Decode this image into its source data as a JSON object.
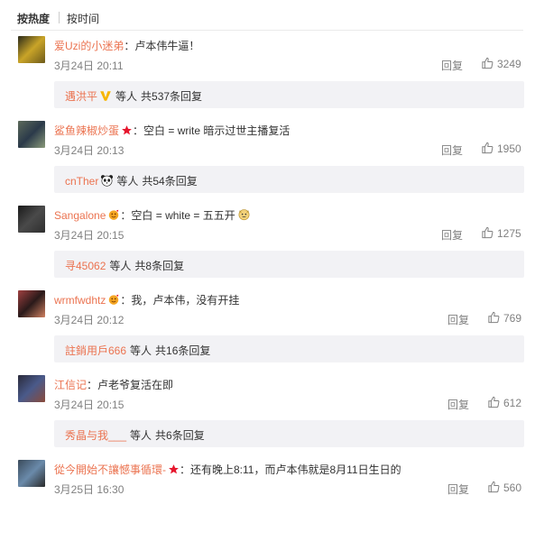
{
  "sort": {
    "hot": "按热度",
    "time": "按时间"
  },
  "comments": [
    {
      "user": "爱Uzi的小迷弟",
      "text": "：卢本伟牛逼！",
      "time": "3月24日 20:11",
      "reply": "回复",
      "likes": "3249",
      "avatar_colors": [
        "#2a2a1a",
        "#c9a428",
        "#6d5a1a"
      ],
      "sub": {
        "user": "遇洪平",
        "badge": "vip",
        "suffix": "等人",
        "more": "共537条回复"
      }
    },
    {
      "user": "鲨鱼辣椒炒蛋",
      "badge": "star",
      "text": "：空白 = write 暗示过世主播复活",
      "time": "3月24日 20:13",
      "reply": "回复",
      "likes": "1950",
      "avatar_colors": [
        "#5c6a5a",
        "#2b3a4a",
        "#8a9a7a"
      ],
      "sub": {
        "user": "cnTher",
        "badge": "panda",
        "suffix": "等人",
        "more": "共54条回复"
      }
    },
    {
      "user": "Sangalone",
      "badge": "emoji",
      "text": "：空白 = white = 五五开",
      "trail_emoji": true,
      "time": "3月24日 20:15",
      "reply": "回复",
      "likes": "1275",
      "avatar_colors": [
        "#1a1a1a",
        "#4a4a4a",
        "#2e2e2e"
      ],
      "sub": {
        "user": "寻45062",
        "suffix": "等人",
        "more": "共8条回复"
      }
    },
    {
      "user": "wrmfwdhtz",
      "badge": "emoji",
      "text": "：我，卢本伟，没有开挂",
      "time": "3月24日 20:12",
      "reply": "回复",
      "likes": "769",
      "avatar_colors": [
        "#a04040",
        "#2a1a1a",
        "#d08060"
      ],
      "sub": {
        "user": "註銷用戶666",
        "suffix": "等人",
        "more": "共16条回复"
      }
    },
    {
      "user": "江信记",
      "text": "：卢老爷复活在即",
      "time": "3月24日 20:15",
      "reply": "回复",
      "likes": "612",
      "avatar_colors": [
        "#2a2a3a",
        "#4a5a8a",
        "#8a4a3a"
      ],
      "sub": {
        "user": "秀晶与我___",
        "suffix": "等人",
        "more": "共6条回复"
      }
    },
    {
      "user": "從今開始不讓憾事循環-",
      "badge": "star",
      "text": "：还有晚上8:11，而卢本伟就是8月11日生日的",
      "time": "3月25日 16:30",
      "reply": "回复",
      "likes": "560",
      "avatar_colors": [
        "#3a4a5a",
        "#6a8aaa",
        "#2a2a2a"
      ]
    }
  ]
}
